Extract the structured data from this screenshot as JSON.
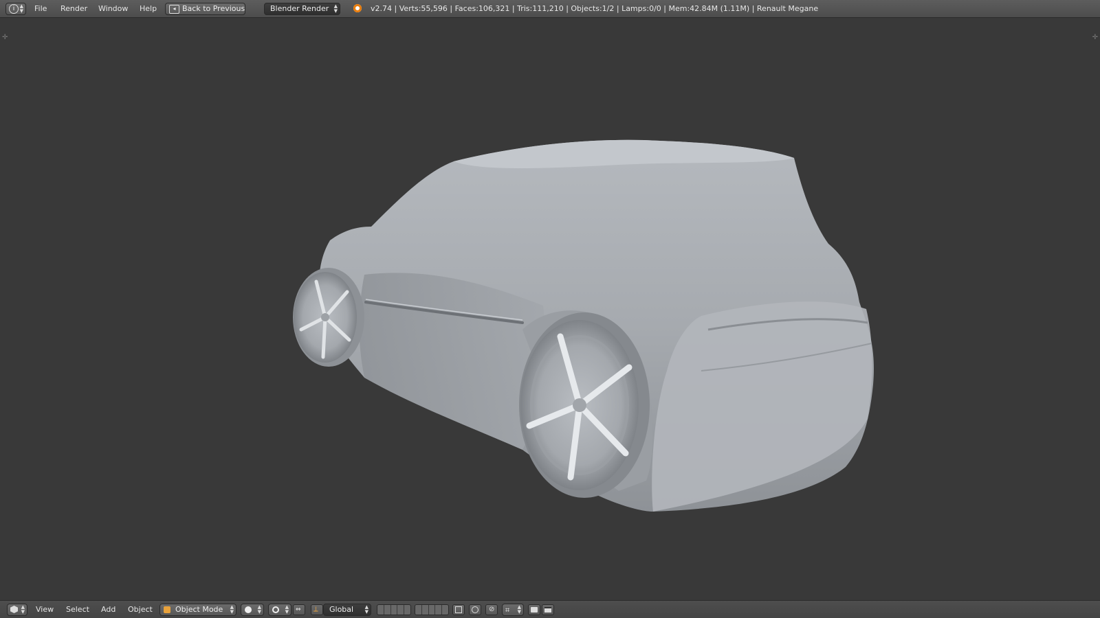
{
  "top_menu": {
    "info_icon": "info-icon",
    "items": [
      "File",
      "Render",
      "Window",
      "Help"
    ],
    "back_button": "Back to Previous",
    "render_engine": "Blender Render",
    "stats": "v2.74 | Verts:55,596 | Faces:106,321 | Tris:111,210 | Objects:1/2 | Lamps:0/0 | Mem:42.84M (1.11M) | Renault Megane"
  },
  "bottom_menu": {
    "items": [
      "View",
      "Select",
      "Add",
      "Object"
    ],
    "mode": "Object Mode",
    "orientation": "Global"
  },
  "colors": {
    "viewport_bg": "#393939",
    "header_bg": "#555555",
    "model_color": "#a9adb2"
  }
}
